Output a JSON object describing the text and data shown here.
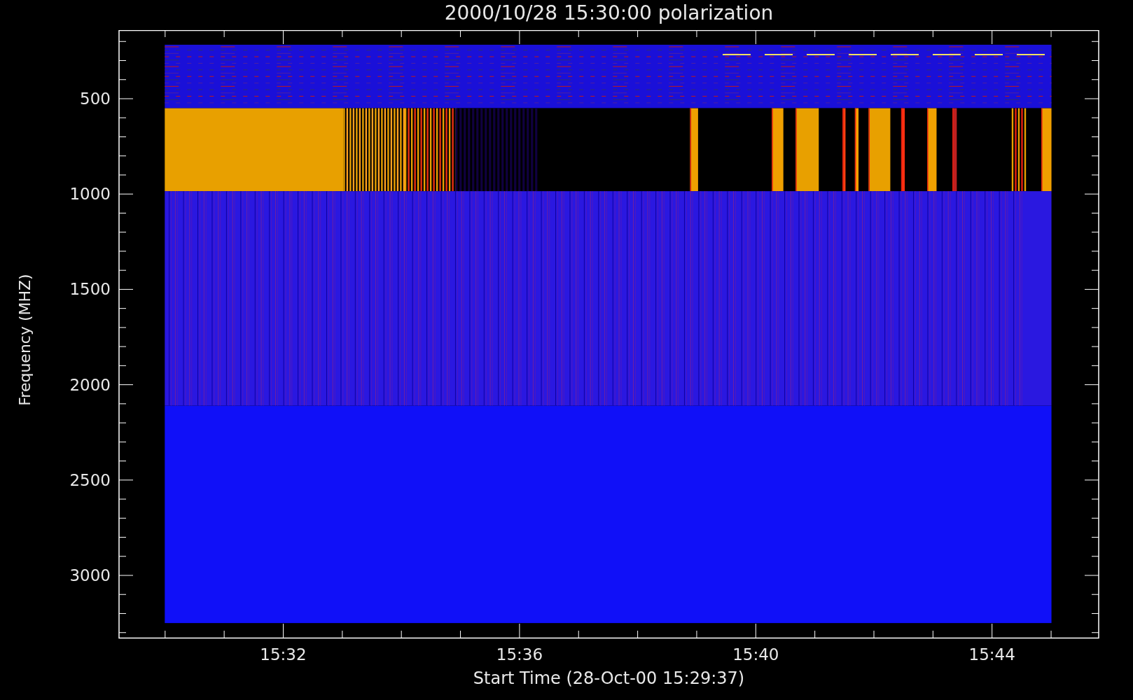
{
  "title": "2000/10/28 15:30:00 polarization",
  "y_axis": {
    "label": "Frequency (MHZ)",
    "ticks": [
      "500",
      "1000",
      "1500",
      "2000",
      "2500",
      "3000"
    ]
  },
  "x_axis": {
    "label": "Start Time (28-Oct-00 15:29:37)",
    "ticks": [
      "15:32",
      "15:36",
      "15:40",
      "15:44"
    ]
  }
}
